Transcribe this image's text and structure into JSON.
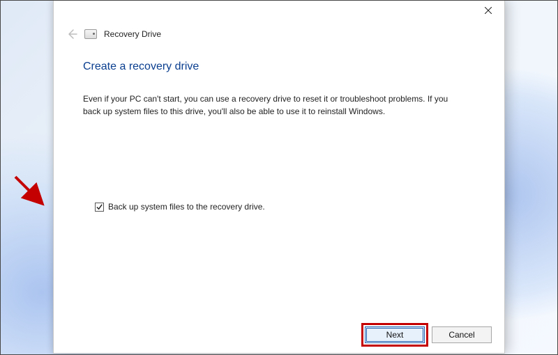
{
  "window": {
    "app_title": "Recovery Drive"
  },
  "page": {
    "title": "Create a recovery drive",
    "description": "Even if your PC can't start, you can use a recovery drive to reset it or troubleshoot problems. If you back up system files to this drive, you'll also be able to use it to reinstall Windows."
  },
  "option": {
    "backup_label": "Back up system files to the recovery drive.",
    "backup_checked": true
  },
  "buttons": {
    "next": "Next",
    "cancel": "Cancel"
  }
}
